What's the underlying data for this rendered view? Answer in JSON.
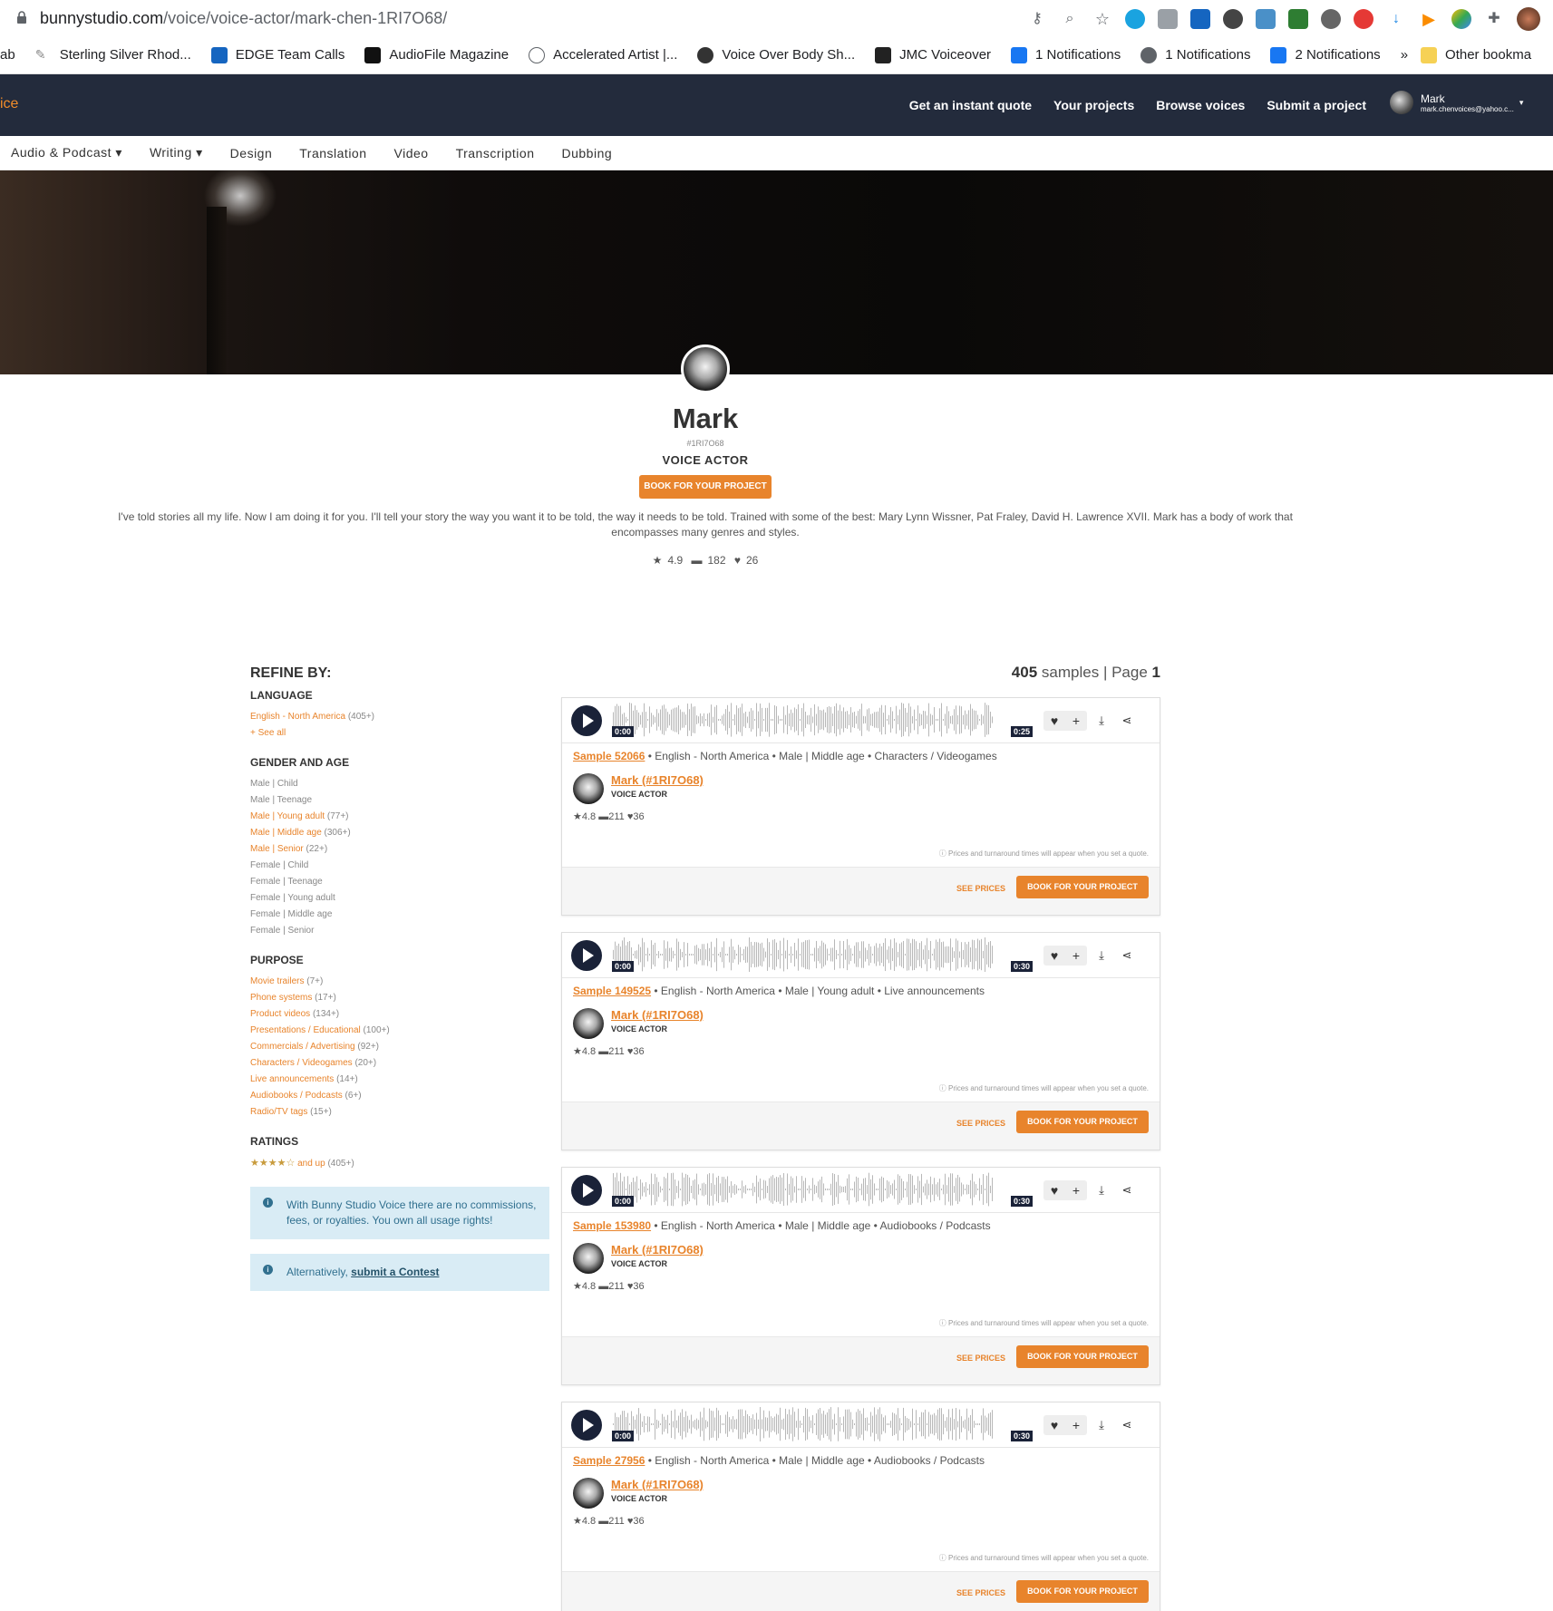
{
  "browser": {
    "url_host": "bunnystudio.com",
    "url_path": "/voice/voice-actor/mark-chen-1RI7O68/",
    "bookmarks": [
      {
        "label": "ab"
      },
      {
        "label": "Sterling Silver Rhod..."
      },
      {
        "label": "EDGE Team Calls"
      },
      {
        "label": "AudioFile Magazine"
      },
      {
        "label": "Accelerated Artist |..."
      },
      {
        "label": "Voice Over Body Sh..."
      },
      {
        "label": "JMC Voiceover"
      },
      {
        "label": "1 Notifications"
      },
      {
        "label": "1 Notifications"
      },
      {
        "label": "2 Notifications"
      },
      {
        "label": "»"
      },
      {
        "label": "Other bookma"
      }
    ]
  },
  "site": {
    "brand": "ice",
    "nav": [
      "Get an instant quote",
      "Your projects",
      "Browse voices",
      "Submit a project"
    ],
    "user_name": "Mark",
    "user_email": "mark.chenvoices@yahoo.c...",
    "subnav": [
      "Audio & Podcast ▾",
      "Writing ▾",
      "Design",
      "Translation",
      "Video",
      "Transcription",
      "Dubbing"
    ]
  },
  "profile": {
    "name": "Mark",
    "id": "#1RI7O68",
    "role": "VOICE ACTOR",
    "book_label": "BOOK FOR YOUR PROJECT",
    "bio": "I've told stories all my life. Now I am doing it for you. I'll tell your story the way you want it to be told, the way it needs to be told. Trained with some of the best: Mary Lynn Wissner, Pat Fraley, David H. Lawrence XVII. Mark has a body of work that encompasses many genres and styles.",
    "rating": "4.9",
    "projects": "182",
    "likes": "26"
  },
  "sidebar": {
    "title": "REFINE BY:",
    "language_title": "LANGUAGE",
    "language": [
      {
        "label": "English - North America",
        "count": "(405+)",
        "active": true
      }
    ],
    "see_all": "+ See all",
    "gender_title": "GENDER AND AGE",
    "gender": [
      {
        "label": "Male | Child",
        "count": "",
        "active": false
      },
      {
        "label": "Male | Teenage",
        "count": "",
        "active": false
      },
      {
        "label": "Male | Young adult",
        "count": "(77+)",
        "active": true
      },
      {
        "label": "Male | Middle age",
        "count": "(306+)",
        "active": true
      },
      {
        "label": "Male | Senior",
        "count": "(22+)",
        "active": true
      },
      {
        "label": "Female | Child",
        "count": "",
        "active": false
      },
      {
        "label": "Female | Teenage",
        "count": "",
        "active": false
      },
      {
        "label": "Female | Young adult",
        "count": "",
        "active": false
      },
      {
        "label": "Female | Middle age",
        "count": "",
        "active": false
      },
      {
        "label": "Female | Senior",
        "count": "",
        "active": false
      }
    ],
    "purpose_title": "PURPOSE",
    "purpose": [
      {
        "label": "Movie trailers",
        "count": "(7+)"
      },
      {
        "label": "Phone systems",
        "count": "(17+)"
      },
      {
        "label": "Product videos",
        "count": "(134+)"
      },
      {
        "label": "Presentations / Educational",
        "count": "(100+)"
      },
      {
        "label": "Commercials / Advertising",
        "count": "(92+)"
      },
      {
        "label": "Characters / Videogames",
        "count": "(20+)"
      },
      {
        "label": "Live announcements",
        "count": "(14+)"
      },
      {
        "label": "Audiobooks / Podcasts",
        "count": "(6+)"
      },
      {
        "label": "Radio/TV tags",
        "count": "(15+)"
      }
    ],
    "ratings_title": "RATINGS",
    "ratings_label": "and up",
    "ratings_count": "(405+)",
    "info": "With Bunny Studio Voice there are no commissions, fees, or royalties. You own all usage rights!",
    "alt_prefix": "Alternatively, ",
    "alt_link": "submit a Contest"
  },
  "results": {
    "count": "405",
    "count_label": "samples",
    "page_label": "Page",
    "page": "1",
    "samples": [
      {
        "sample": "Sample 52066",
        "meta": " • English - North America • Male | Middle age • Characters / Videogames",
        "start": "0:00",
        "end": "0:25"
      },
      {
        "sample": "Sample 149525",
        "meta": " • English - North America • Male | Young adult • Live announcements",
        "start": "0:00",
        "end": "0:30"
      },
      {
        "sample": "Sample 153980",
        "meta": " • English - North America • Male | Middle age • Audiobooks / Podcasts",
        "start": "0:00",
        "end": "0:30"
      },
      {
        "sample": "Sample 27956",
        "meta": " • English - North America • Male | Middle age • Audiobooks / Podcasts",
        "start": "0:00",
        "end": "0:30"
      }
    ],
    "actor_name": "Mark (#1RI7O68)",
    "actor_role": "VOICE ACTOR",
    "actor_rating": "4.8",
    "actor_projects": "211",
    "actor_likes": "36",
    "note": "Prices and turnaround times will appear when you set a quote.",
    "see_prices": "SEE PRICES",
    "book_label": "BOOK FOR YOUR PROJECT"
  },
  "colors": {
    "accent": "#e8842c",
    "nav_bg": "#232b3c",
    "player": "#1a2238"
  }
}
